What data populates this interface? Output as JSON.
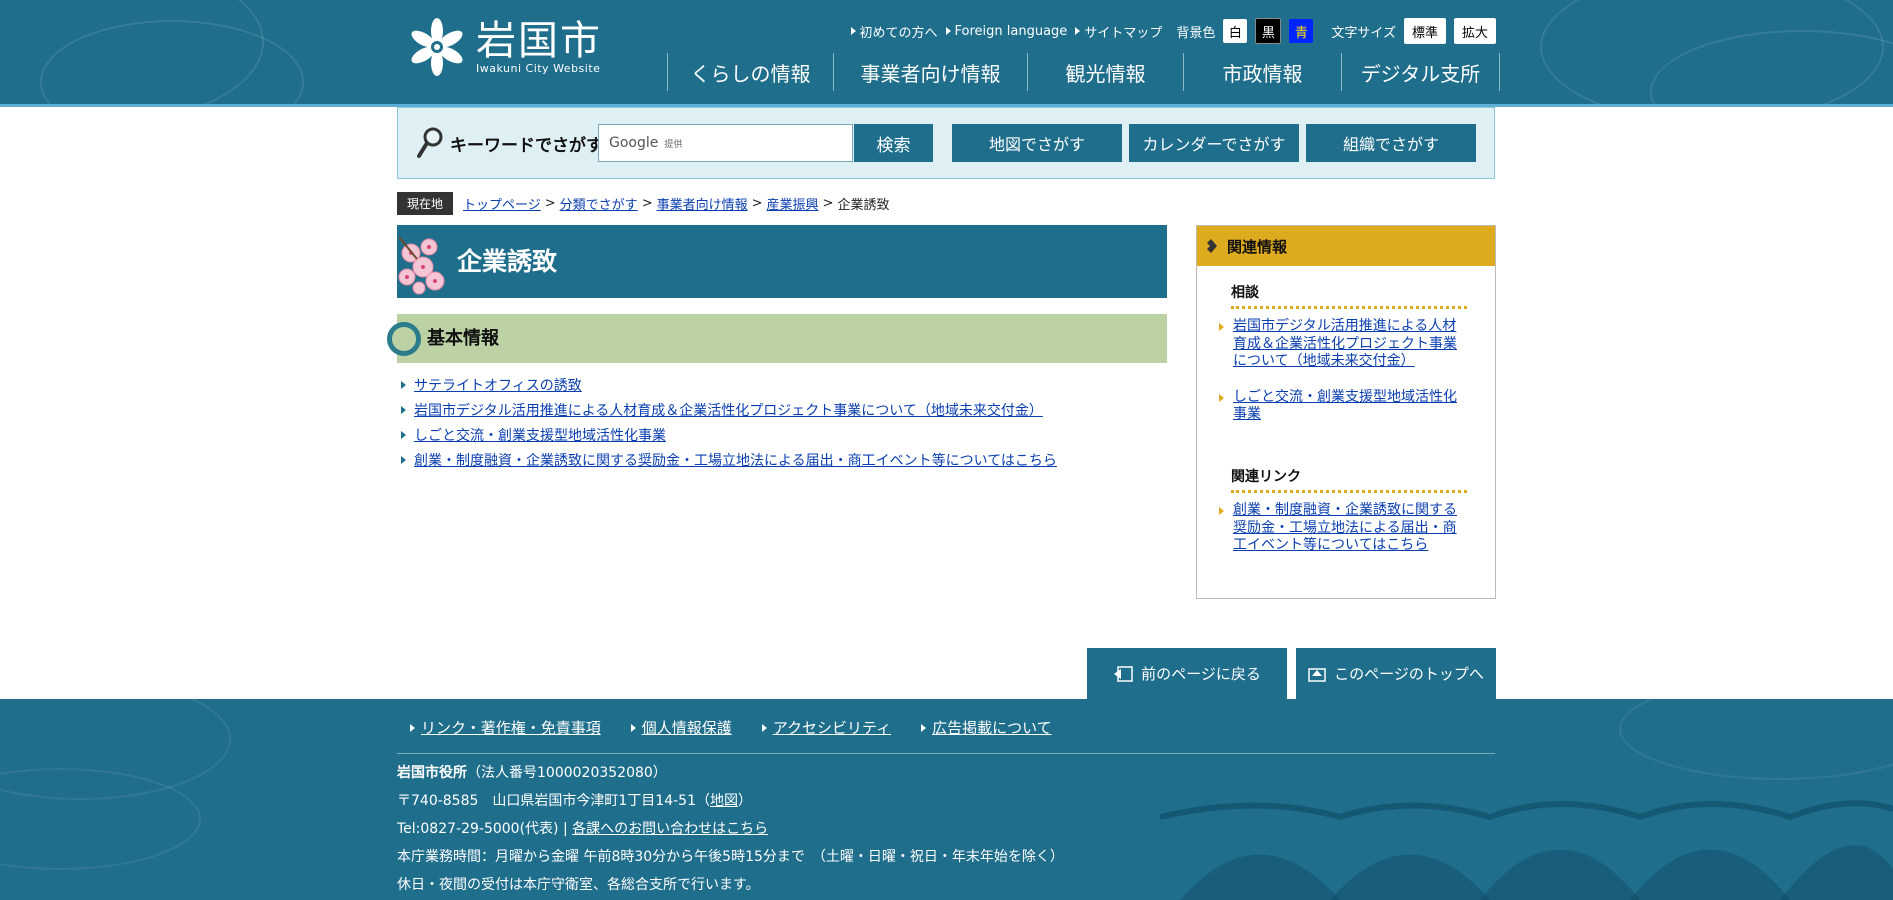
{
  "header": {
    "logo_jp": "岩国市",
    "logo_en": "Iwakuni City Website",
    "util_links": [
      "初めての方へ",
      "Foreign language",
      "サイトマップ"
    ],
    "bg_label": "背景色",
    "bg_white": "白",
    "bg_black": "黒",
    "bg_blue": "青",
    "font_label": "文字サイズ",
    "font_standard": "標準",
    "font_large": "拡大",
    "nav": [
      "くらしの情報",
      "事業者向け情報",
      "観光情報",
      "市政情報",
      "デジタル支所"
    ]
  },
  "search": {
    "label": "キーワードでさがす",
    "placeholder": "Google",
    "provided": "提供",
    "button": "検索",
    "buttons": [
      "地図でさがす",
      "カレンダーでさがす",
      "組織でさがす"
    ]
  },
  "breadcrumb": {
    "here": "現在地",
    "items": [
      "トップページ",
      "分類でさがす",
      "事業者向け情報",
      "産業振興"
    ],
    "current": "企業誘致",
    "sep": ">"
  },
  "main": {
    "title": "企業誘致",
    "section": "基本情報",
    "links": [
      "サテライトオフィスの誘致",
      "岩国市デジタル活用推進による人材育成＆企業活性化プロジェクト事業について（地域未来交付金）",
      "しごと交流・創業支援型地域活性化事業",
      "創業・制度融資・企業誘致に関する奨励金・工場立地法による届出・商工イベント等についてはこちら"
    ]
  },
  "side": {
    "heading": "関連情報",
    "consult_title": "相談",
    "consult_links": [
      "岩国市デジタル活用推進による人材育成＆企業活性化プロジェクト事業について（地域未来交付金）",
      "しごと交流・創業支援型地域活性化事業"
    ],
    "related_title": "関連リンク",
    "related_links": [
      "創業・制度融資・企業誘致に関する奨励金・工場立地法による届出・商工イベント等についてはこちら"
    ]
  },
  "page_buttons": {
    "back": "前のページに戻る",
    "top": "このページのトップへ"
  },
  "footer": {
    "links": [
      "リンク・著作権・免責事項",
      "個人情報保護",
      "アクセシビリティ",
      "広告掲載について"
    ],
    "office": "岩国市役所",
    "corp_no": "（法人番号1000020352080）",
    "address": "〒740-8585　山口県岩国市今津町1丁目14-51（",
    "map_link": "地図",
    "address_end": "）",
    "tel": "Tel:0827-29-5000(代表) | ",
    "contact_link": "各課へのお問い合わせはこちら",
    "hours": "本庁業務時間：月曜から金曜 午前8時30分から午後5時15分まで　（土曜・日曜・祝日・年末年始を除く）",
    "holiday": "休日・夜間の受付は本庁守衛室、各総合支所で行います。"
  },
  "colors": {
    "primary": "#1f6e8c",
    "accent": "#deab1f",
    "section": "#bcd2a5",
    "searchbar": "#dff0f5"
  }
}
